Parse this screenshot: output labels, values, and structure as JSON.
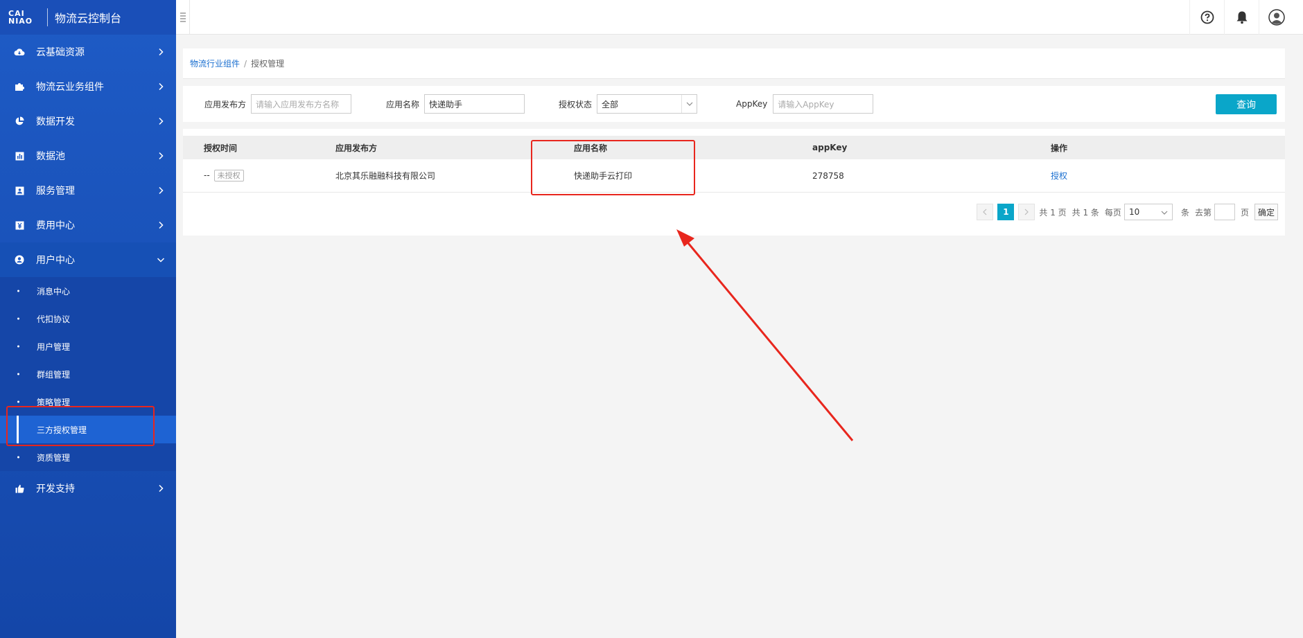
{
  "brand": {
    "logo_line1": "CAI",
    "logo_line2": "NIAO",
    "title": "物流云控制台"
  },
  "sidebar": {
    "items": [
      {
        "label": "云基础资源",
        "icon": "cloud-icon"
      },
      {
        "label": "物流云业务组件",
        "icon": "puzzle-icon"
      },
      {
        "label": "数据开发",
        "icon": "pie-chart-icon"
      },
      {
        "label": "数据池",
        "icon": "bar-chart-icon"
      },
      {
        "label": "服务管理",
        "icon": "id-card-icon"
      },
      {
        "label": "费用中心",
        "icon": "yen-icon"
      },
      {
        "label": "用户中心",
        "icon": "user-circle-icon",
        "expanded": true
      }
    ],
    "user_center_sub": [
      "消息中心",
      "代扣协议",
      "用户管理",
      "群组管理",
      "策略管理",
      "三方授权管理",
      "资质管理"
    ],
    "active_sub": "三方授权管理",
    "after_items": [
      {
        "label": "开发支持",
        "icon": "thumbs-up-icon"
      }
    ]
  },
  "breadcrumb": {
    "parent": "物流行业组件",
    "separator": "/",
    "current": "授权管理"
  },
  "filters": {
    "publisher_label": "应用发布方",
    "publisher_placeholder": "请输入应用发布方名称",
    "app_name_label": "应用名称",
    "app_name_value": "快递助手",
    "status_label": "授权状态",
    "status_value": "全部",
    "appkey_label": "AppKey",
    "appkey_placeholder": "请输入AppKey",
    "search_button": "查询"
  },
  "table": {
    "columns": [
      "授权时间",
      "应用发布方",
      "应用名称",
      "appKey",
      "操作"
    ],
    "rows": [
      {
        "time": "--",
        "status_badge": "未授权",
        "publisher": "北京其乐融融科技有限公司",
        "app_name": "快递助手云打印",
        "appkey": "278758",
        "action": "授权"
      }
    ]
  },
  "pagination": {
    "current_page": "1",
    "total_pages_text": "共 1 页",
    "total_items_text": "共 1 条",
    "per_page_label": "每页",
    "per_page_value": "10",
    "per_page_unit": "条",
    "goto_label": "去第",
    "goto_unit": "页",
    "confirm": "确定"
  },
  "colors": {
    "sidebar": "#1e5bc6",
    "active": "#1e63d3",
    "accent": "#0aa6c9",
    "annotation": "#e8261d",
    "link": "#1a6fd0"
  }
}
